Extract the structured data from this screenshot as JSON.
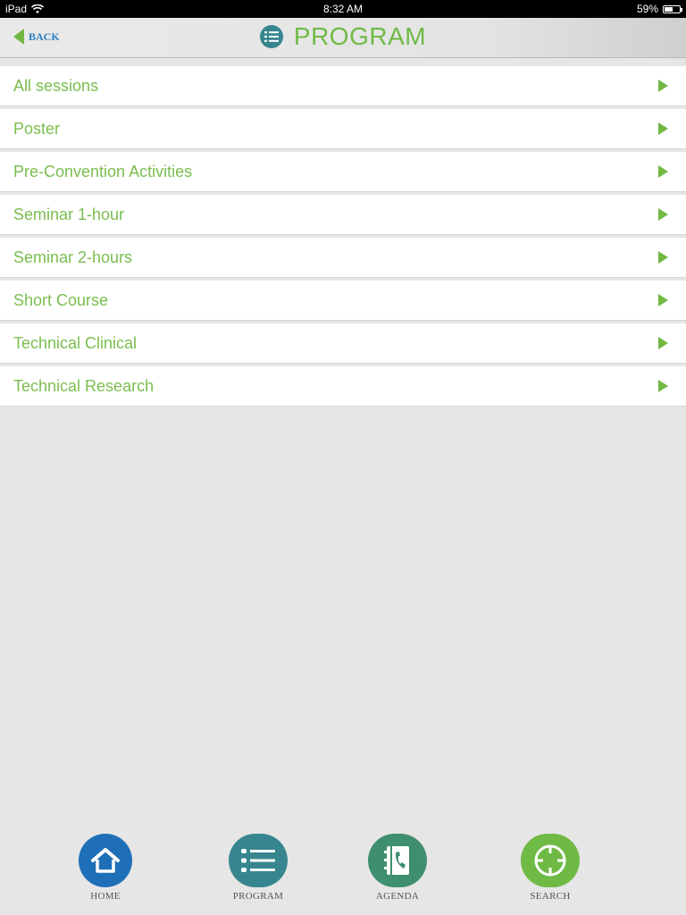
{
  "status_bar": {
    "device": "iPad",
    "time": "8:32 AM",
    "battery": "59%",
    "battery_level": 0.59
  },
  "header": {
    "back_label": "BACK",
    "title": "PROGRAM",
    "title_icon": "list-icon"
  },
  "sessions": [
    {
      "label": "All sessions"
    },
    {
      "label": "Poster"
    },
    {
      "label": "Pre-Convention Activities"
    },
    {
      "label": "Seminar 1-hour"
    },
    {
      "label": "Seminar 2-hours"
    },
    {
      "label": "Short Course"
    },
    {
      "label": "Technical Clinical"
    },
    {
      "label": "Technical Research"
    }
  ],
  "tabs": [
    {
      "label": "HOME",
      "icon": "home-icon",
      "color": "#1f6fb8"
    },
    {
      "label": "PROGRAM",
      "icon": "list-icon",
      "color": "#37868f"
    },
    {
      "label": "AGENDA",
      "icon": "address-book-icon",
      "color": "#3f8f6e"
    },
    {
      "label": "SEARCH",
      "icon": "crosshair-icon",
      "color": "#6fba45"
    }
  ],
  "colors": {
    "accent_green": "#7bbd4f",
    "back_blue": "#2a7fc0",
    "title_icon_teal": "#37868f"
  }
}
